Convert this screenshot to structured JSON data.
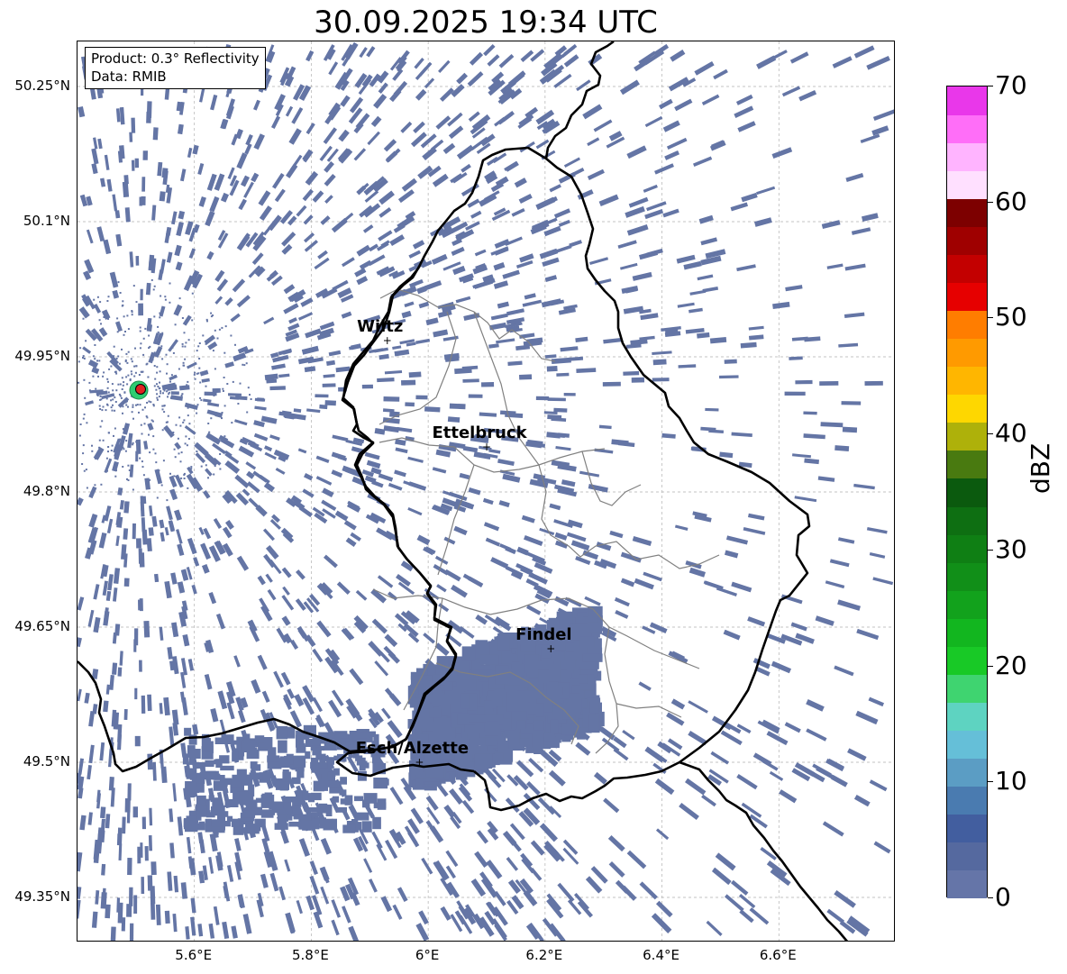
{
  "title": "30.09.2025 19:34 UTC",
  "info": {
    "product": "Product: 0.3° Reflectivity",
    "data": "Data: RMIB"
  },
  "axes": {
    "lon_ticks": [
      "5.6°E",
      "5.8°E",
      "6°E",
      "6.2°E",
      "6.4°E",
      "6.6°E"
    ],
    "lat_ticks": [
      "50.25°N",
      "50.1°N",
      "49.95°N",
      "49.8°N",
      "49.65°N",
      "49.5°N",
      "49.35°N"
    ],
    "grid": true
  },
  "cities": [
    {
      "name": "Wiltz",
      "lon": 5.93,
      "lat": 49.968
    },
    {
      "name": "Ettelbruck",
      "lon": 6.1,
      "lat": 49.85
    },
    {
      "name": "Findel",
      "lon": 6.21,
      "lat": 49.626
    },
    {
      "name": "Esch/Alzette",
      "lon": 5.985,
      "lat": 49.5
    }
  ],
  "radar_site": {
    "lon": 5.505,
    "lat": 49.914
  },
  "colorbar": {
    "label": "dBZ",
    "ticks": [
      "0",
      "10",
      "20",
      "30",
      "40",
      "50",
      "60",
      "70"
    ],
    "min": 0,
    "max": 70,
    "colors": [
      "#6575a8",
      "#55699f",
      "#425e9f",
      "#4a7bb0",
      "#5b9dc4",
      "#65bfd8",
      "#5ed3c1",
      "#3fd470",
      "#18c926",
      "#12b61f",
      "#12a21c",
      "#118f18",
      "#0f7f14",
      "#0e6f12",
      "#0b5a0e",
      "#497a10",
      "#aeb10a",
      "#fed700",
      "#ffb600",
      "#ff9a00",
      "#ff7d00",
      "#e60000",
      "#c30000",
      "#9f0000",
      "#7d0000",
      "#ffe0ff",
      "#ffb4ff",
      "#ff6ef8",
      "#e937ea"
    ]
  },
  "colors": {
    "echo": "#6475a5",
    "border": "#000000",
    "canton": "#808080",
    "radar_outer": "#2ecc71",
    "radar_inner": "#e02020"
  }
}
